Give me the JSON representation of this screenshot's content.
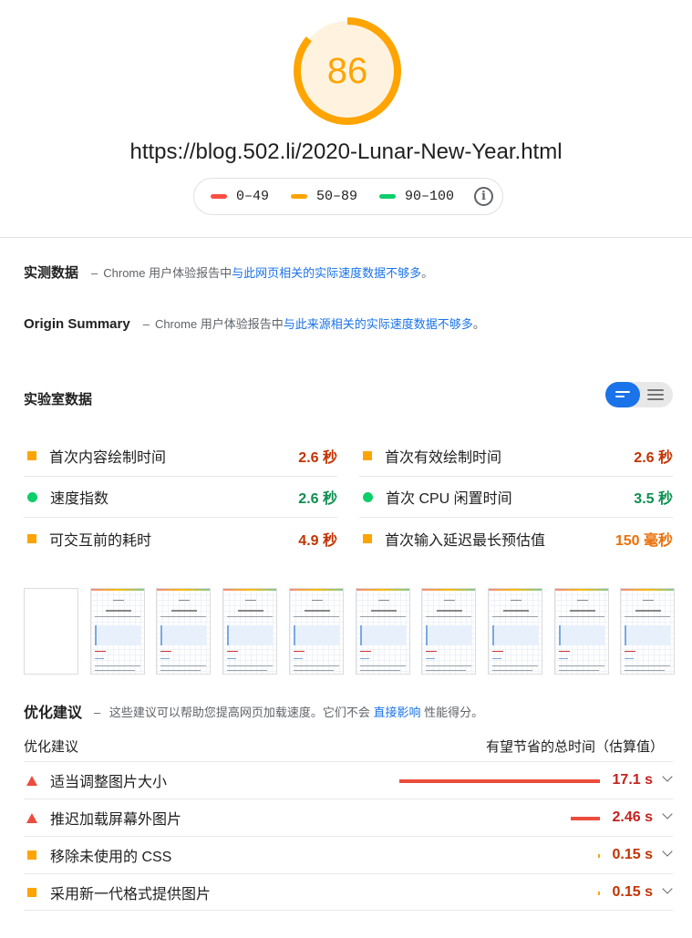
{
  "score": {
    "value": "86",
    "fraction": 0.86,
    "color": "#ffa400"
  },
  "url": "https://blog.502.li/2020-Lunar-New-Year.html",
  "legend": [
    {
      "label": "0–49",
      "color": "#ff4e42"
    },
    {
      "label": "50–89",
      "color": "#ffa400"
    },
    {
      "label": "90–100",
      "color": "#0cce6b"
    }
  ],
  "field": {
    "title": "实测数据",
    "dash": "–",
    "prefix": "Chrome 用户体验报告中",
    "link": "与此网页相关的实际速度数据不够多",
    "suffix": "。"
  },
  "origin": {
    "title": "Origin Summary",
    "dash": "–",
    "prefix": "Chrome 用户体验报告中",
    "link": "与此来源相关的实际速度数据不够多",
    "suffix": "。"
  },
  "lab": {
    "title": "实验室数据",
    "metrics_left": [
      {
        "label": "首次内容绘制时间",
        "value": "2.6 秒",
        "status": "average"
      },
      {
        "label": "速度指数",
        "value": "2.6 秒",
        "status": "pass"
      },
      {
        "label": "可交互前的耗时",
        "value": "4.9 秒",
        "status": "average"
      }
    ],
    "metrics_right": [
      {
        "label": "首次有效绘制时间",
        "value": "2.6 秒",
        "status": "average"
      },
      {
        "label": "首次 CPU 闲置时间",
        "value": "3.5 秒",
        "status": "pass"
      },
      {
        "label": "首次输入延迟最长预估值",
        "value": "150 毫秒",
        "status": "average"
      }
    ]
  },
  "opportunities": {
    "title": "优化建议",
    "dash": "–",
    "desc_prefix": "这些建议可以帮助您提高网页加载速度。它们不会",
    "desc_link": "直接影响",
    "desc_suffix": "性能得分。",
    "col_left": "优化建议",
    "col_right": "有望节省的总时间（估算值）",
    "items": [
      {
        "label": "适当调整图片大小",
        "value": "17.1 s",
        "severity": "fail",
        "savings_fraction": 1.0
      },
      {
        "label": "推迟加载屏幕外图片",
        "value": "2.46 s",
        "severity": "fail",
        "savings_fraction": 0.144
      },
      {
        "label": "移除未使用的 CSS",
        "value": "0.15 s",
        "severity": "average",
        "savings_fraction": 0.009
      },
      {
        "label": "采用新一代格式提供图片",
        "value": "0.15 s",
        "severity": "average",
        "savings_fraction": 0.009
      }
    ]
  }
}
